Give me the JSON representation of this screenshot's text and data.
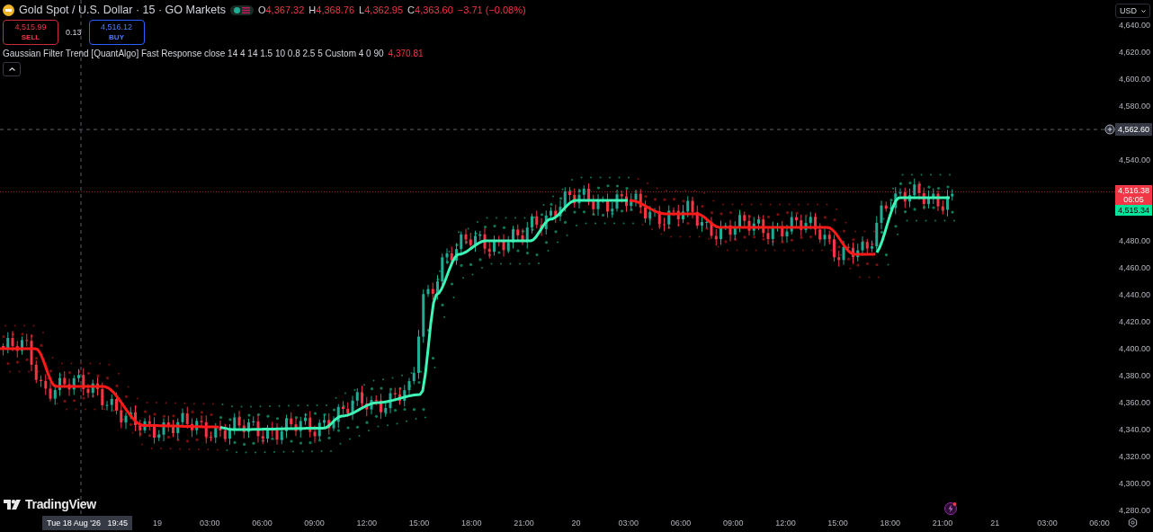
{
  "header": {
    "title": "Gold Spot / U.S. Dollar · 15 · GO Markets",
    "ohlc": [
      {
        "label": "O",
        "value": "4,367.32"
      },
      {
        "label": "H",
        "value": "4,368.76"
      },
      {
        "label": "L",
        "value": "4,362.95"
      },
      {
        "label": "C",
        "value": "4,363.60"
      }
    ],
    "change": "−3.71 (−0.08%)"
  },
  "trade": {
    "sell": {
      "price": "4,515.99",
      "label": "SELL"
    },
    "spread": "0.13",
    "buy": {
      "price": "4,516.12",
      "label": "BUY"
    }
  },
  "indicator": {
    "text": "Gaussian Filter Trend [QuantAlgo] Fast Response close 14 4 14 1.5 10 0.8 2.5 5 Custom 4 0 90",
    "value": "4,370.81"
  },
  "currency": "USD",
  "price_axis": {
    "labels": [
      "4,640.00",
      "4,620.00",
      "4,600.00",
      "4,580.00",
      "4,540.00",
      "4,480.00",
      "4,460.00",
      "4,440.00",
      "4,420.00",
      "4,400.00",
      "4,380.00",
      "4,360.00",
      "4,340.00",
      "4,320.00",
      "4,300.00",
      "4,280.00"
    ]
  },
  "crosshair": {
    "price": "4,562.60",
    "time": "Tue 18 Aug '26   19:45"
  },
  "last_price": {
    "price": "4,516.38",
    "countdown": "06:05"
  },
  "trend_price": "4,515.34",
  "time_axis": {
    "labels": [
      "19",
      "03:00",
      "06:00",
      "09:00",
      "12:00",
      "15:00",
      "18:00",
      "21:00",
      "20",
      "03:00",
      "06:00",
      "09:00",
      "12:00",
      "15:00",
      "18:00",
      "21:00",
      "21",
      "03:00",
      "06:00"
    ]
  },
  "brand": "TradingView"
}
